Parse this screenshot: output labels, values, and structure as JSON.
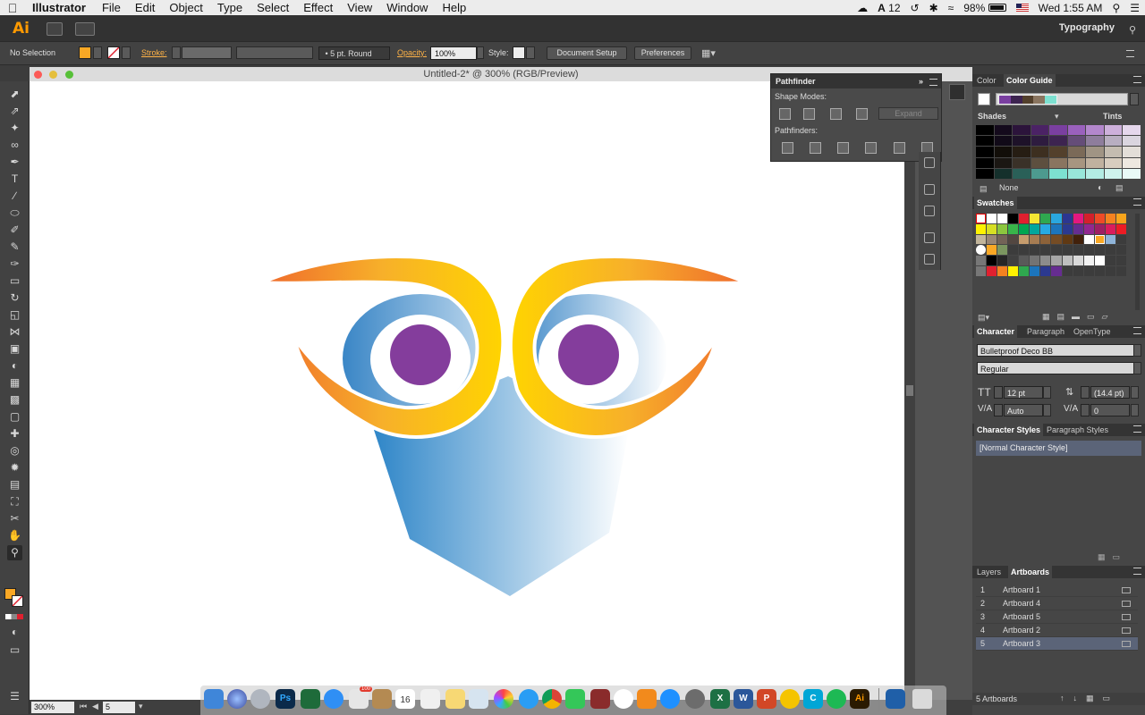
{
  "menubar": {
    "app": "Illustrator",
    "items": [
      "File",
      "Edit",
      "Object",
      "Type",
      "Select",
      "Effect",
      "View",
      "Window",
      "Help"
    ],
    "notif_count": "12",
    "battery": "98%",
    "clock": "Wed 1:55 AM"
  },
  "appbar": {
    "logo": "Ai",
    "workspace": "Typography"
  },
  "control": {
    "selection": "No Selection",
    "stroke_label": "Stroke:",
    "brush": "5 pt. Round",
    "opacity_label": "Opacity:",
    "opacity": "100%",
    "style_label": "Style:",
    "doc_setup": "Document Setup",
    "preferences": "Preferences",
    "fill_color": "#f9a825"
  },
  "document": {
    "title": "Untitled-2* @ 300% (RGB/Preview)",
    "zoom": "300%",
    "page": "5"
  },
  "pathfinder": {
    "title": "Pathfinder",
    "shape_modes": "Shape Modes:",
    "pathfinders": "Pathfinders:",
    "expand": "Expand"
  },
  "color_panel": {
    "tab_color": "Color",
    "tab_guide": "Color Guide",
    "shades": "Shades",
    "tints": "Tints",
    "none": "None"
  },
  "swatches": {
    "title": "Swatches"
  },
  "character": {
    "tabs": [
      "Character",
      "Paragraph",
      "OpenType"
    ],
    "font": "Bulletproof Deco BB",
    "style": "Regular",
    "size": "12 pt",
    "leading": "(14.4 pt)",
    "kerning": "Auto",
    "tracking": "0"
  },
  "char_styles": {
    "tab1": "Character Styles",
    "tab2": "Paragraph Styles",
    "item": "[Normal Character Style]"
  },
  "artboards": {
    "tab_layers": "Layers",
    "tab_artboards": "Artboards",
    "rows": [
      {
        "num": "1",
        "name": "Artboard 1"
      },
      {
        "num": "2",
        "name": "Artboard 4"
      },
      {
        "num": "3",
        "name": "Artboard 5"
      },
      {
        "num": "4",
        "name": "Artboard 2"
      },
      {
        "num": "5",
        "name": "Artboard 3"
      }
    ],
    "footer": "5 Artboards"
  },
  "dock": {
    "ps_label": "Ps",
    "ai_label": "Ai",
    "calendar_day": "16",
    "badge": "100"
  }
}
